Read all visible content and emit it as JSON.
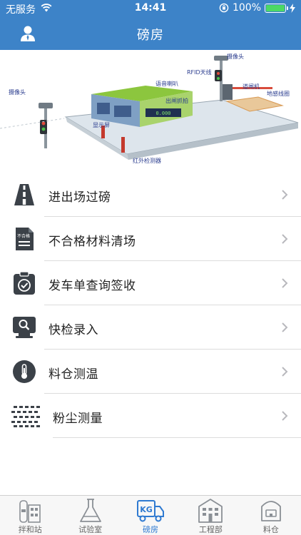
{
  "status_bar": {
    "carrier": "无服务",
    "time": "14:41",
    "battery": "100%",
    "battery_level": 1.0
  },
  "nav": {
    "title": "磅房"
  },
  "hero": {
    "labels": {
      "camera_right": "摄像头",
      "rfid": "RFID天线",
      "speaker": "语音喇叭",
      "camera_left": "摄像头",
      "barrier": "道闸机",
      "ground_coil": "地感线圈",
      "entrance_camera": "出闸抓拍",
      "display": "显示屏",
      "infrared": "红外检测器"
    }
  },
  "menu": {
    "items": [
      {
        "label": "进出场过磅",
        "icon": "road-icon"
      },
      {
        "label": "不合格材料清场",
        "icon": "document-icon",
        "badge": "不合格"
      },
      {
        "label": "发车单查询签收",
        "icon": "clipboard-check-icon"
      },
      {
        "label": "快检录入",
        "icon": "monitor-search-icon"
      },
      {
        "label": "料仓测温",
        "icon": "thermometer-icon"
      },
      {
        "label": "粉尘测量",
        "icon": "dust-icon"
      }
    ]
  },
  "tabs": [
    {
      "label": "拌和站",
      "icon": "mixing-station-icon",
      "active": false
    },
    {
      "label": "试验室",
      "icon": "flask-icon",
      "active": false
    },
    {
      "label": "磅房",
      "icon": "truck-icon",
      "active": true,
      "icon_text": "KG"
    },
    {
      "label": "工程部",
      "icon": "building-icon",
      "active": false
    },
    {
      "label": "料仓",
      "icon": "silo-icon",
      "active": false
    }
  ],
  "colors": {
    "primary": "#3d83c8",
    "active_tab": "#2f7ad1",
    "icon_dark": "#3b4148",
    "divider": "#dcdcdc"
  }
}
